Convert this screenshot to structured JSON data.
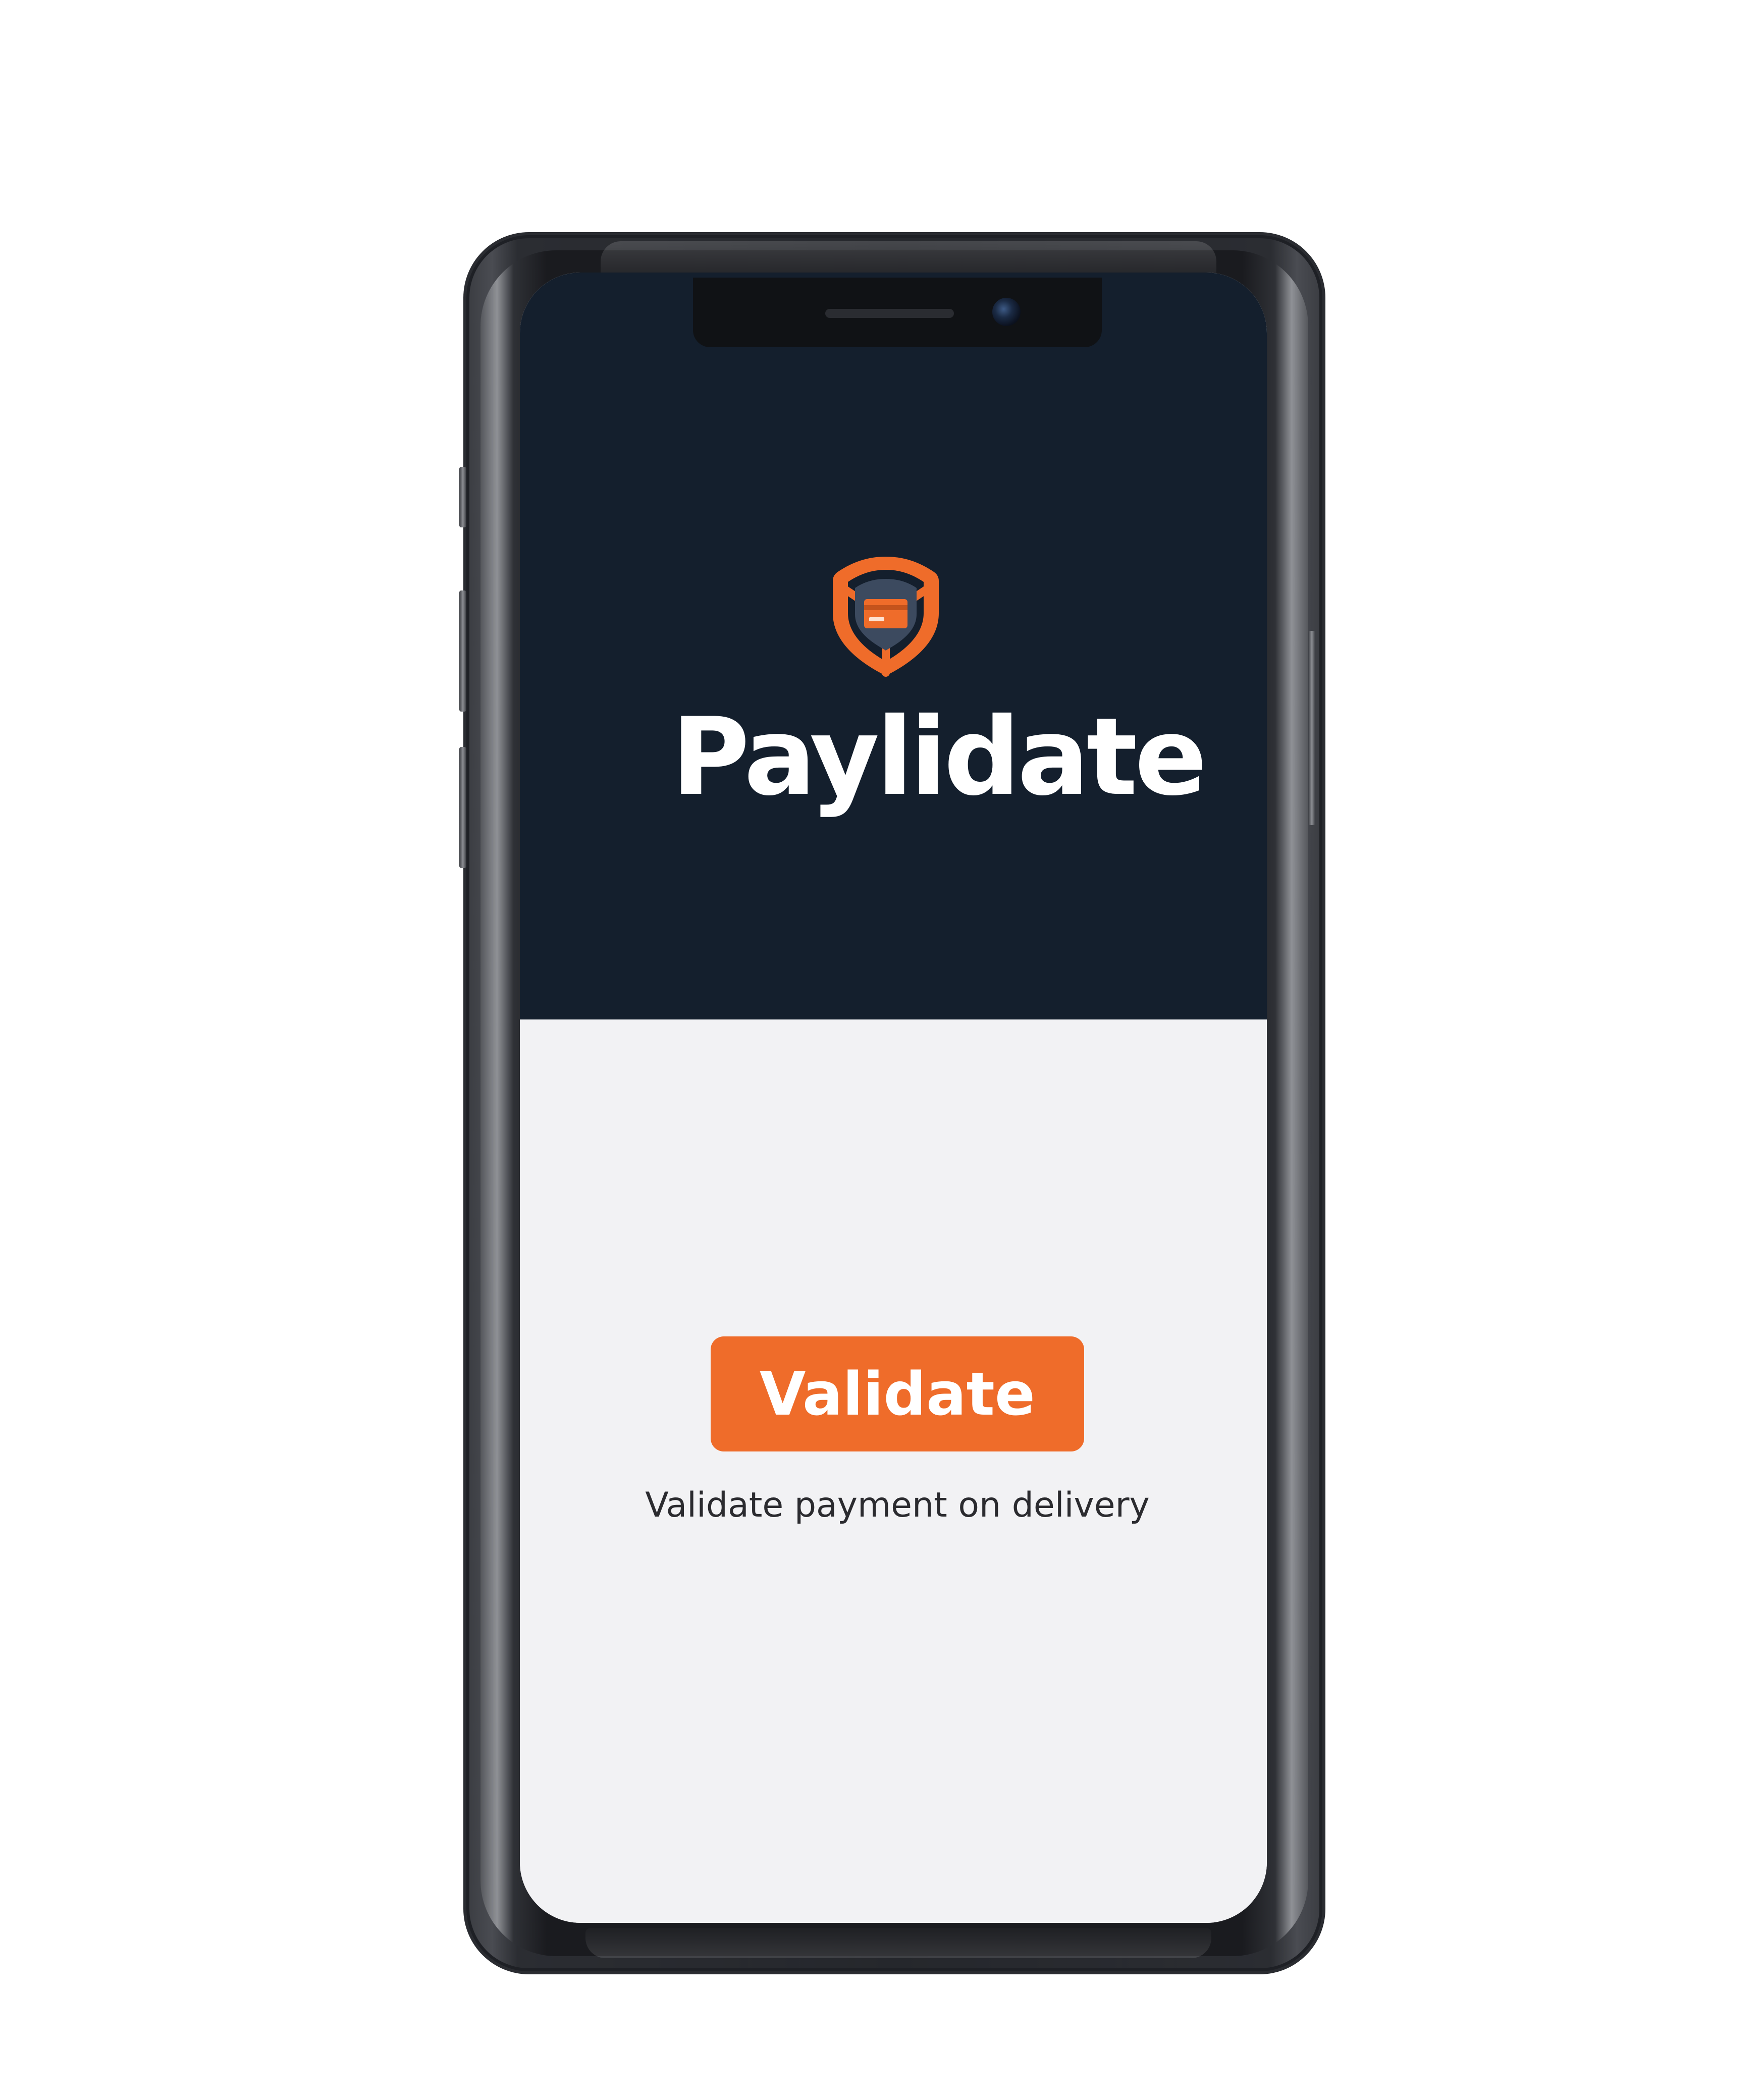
{
  "app": {
    "name": "Paylidate",
    "logo_icon": "shield-card-icon"
  },
  "main": {
    "validate_button_label": "Validate",
    "tagline": "Validate payment on delivery"
  },
  "colors": {
    "header_background": "#141f2d",
    "body_background": "#f2f2f4",
    "accent": "#ef6c2a",
    "title_text": "#ffffff",
    "tagline_text": "#2b2b2f"
  }
}
